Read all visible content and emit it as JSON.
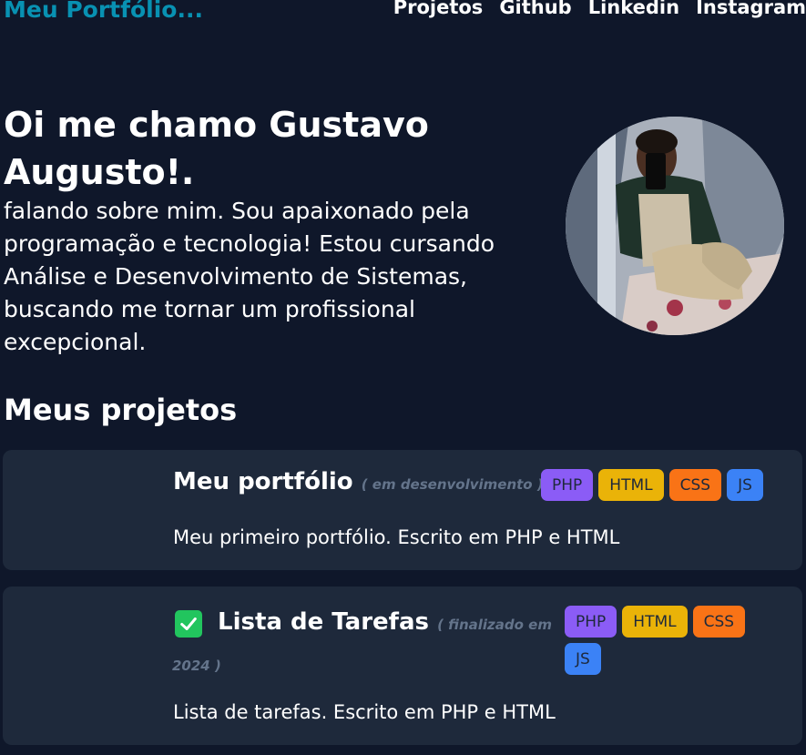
{
  "header": {
    "logo": "Meu Portfólio...",
    "nav": [
      "Projetos",
      "Github",
      "Linkedin",
      "Instagram"
    ]
  },
  "hero": {
    "title": "Oi me chamo Gustavo Augusto!.",
    "bio": "falando sobre mim. Sou apaixonado pela programação e tecnologia! Estou cursando Análise e Desenvolvimento de Sistemas, buscando me tornar um profissional excepcional."
  },
  "projects": {
    "heading": "Meus projetos",
    "items": [
      {
        "title": "Meu portfólio",
        "status": "( em desenvolvimento )",
        "tags": [
          "PHP",
          "HTML",
          "CSS",
          "JS"
        ],
        "description": "Meu primeiro portfólio. Escrito em PHP e HTML"
      },
      {
        "title": "Lista de Tarefas",
        "status_line1": "( finalizado em",
        "status_line2": "2024 )",
        "tags": [
          "PHP",
          "HTML",
          "CSS",
          "JS"
        ],
        "description": "Lista de tarefas. Escrito em PHP e HTML",
        "icon": "check-icon"
      }
    ]
  },
  "colors": {
    "background": "#0f172a",
    "card": "#1e293b",
    "accent": "#0891b2",
    "status": "#64748b",
    "tag_php": "#8b5cf6",
    "tag_html": "#eab308",
    "tag_css": "#f97316",
    "tag_js": "#3b82f6",
    "check": "#22c55e"
  }
}
